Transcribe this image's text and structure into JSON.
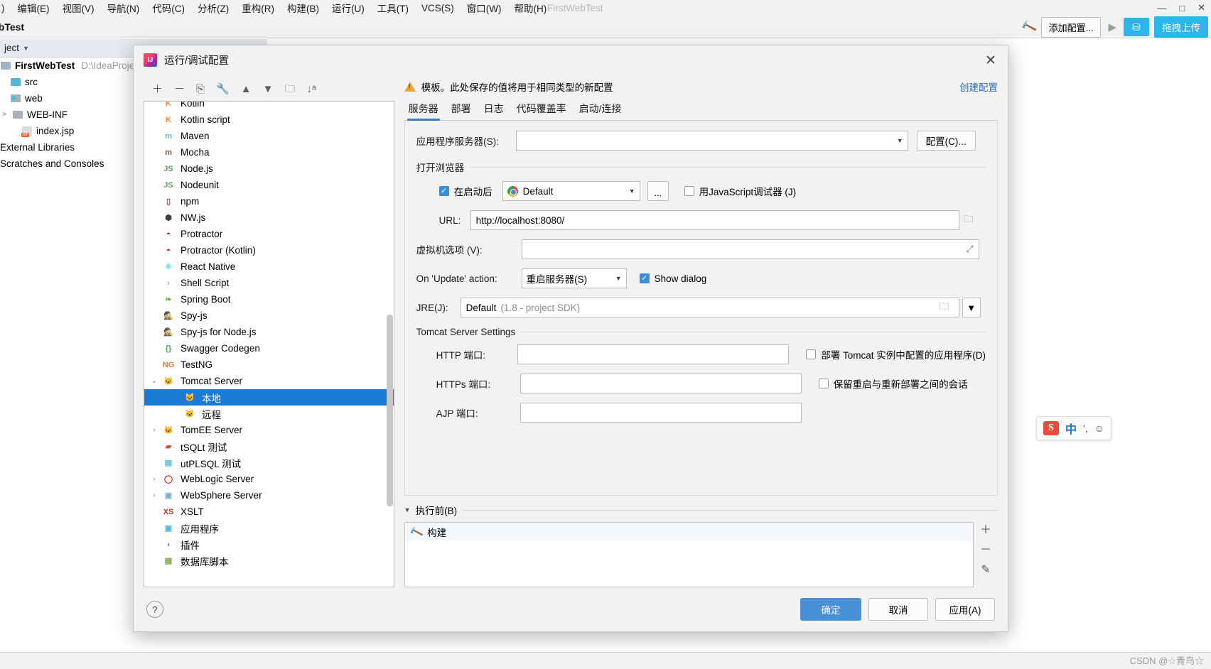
{
  "ide": {
    "window_title": "FirstWebTest",
    "menus": [
      {
        "label": "编辑(E)"
      },
      {
        "label": "视图(V)"
      },
      {
        "label": "导航(N)"
      },
      {
        "label": "代码(C)"
      },
      {
        "label": "分析(Z)"
      },
      {
        "label": "重构(R)"
      },
      {
        "label": "构建(B)"
      },
      {
        "label": "运行(U)"
      },
      {
        "label": "工具(T)"
      },
      {
        "label": "VCS(S)"
      },
      {
        "label": "窗口(W)"
      },
      {
        "label": "帮助(H)"
      }
    ],
    "window_controls": [
      "—",
      "□",
      "✕"
    ],
    "breadcrumb": "ebTest",
    "toolbar": {
      "add_config": "添加配置...",
      "upload": "拖拽上传",
      "cyan_badge": "⛁"
    },
    "tool_tab": "ject",
    "project_tree": [
      {
        "label": "FirstWebTest",
        "path": "D:\\IdeaProject",
        "icon": "module-icon",
        "indent": 0,
        "bold": true,
        "expander": ""
      },
      {
        "label": "src",
        "path": "",
        "icon": "folder-blue-icon",
        "indent": 1,
        "bold": false,
        "expander": ""
      },
      {
        "label": "web",
        "path": "",
        "icon": "web-folder-icon",
        "indent": 1,
        "bold": false,
        "expander": ""
      },
      {
        "label": "WEB-INF",
        "path": "",
        "icon": "folder-gray-icon",
        "indent": 2,
        "bold": false,
        "expander": ">"
      },
      {
        "label": "index.jsp",
        "path": "",
        "icon": "jsp-file-icon",
        "indent": 2,
        "bold": false,
        "expander": ""
      },
      {
        "label": "External Libraries",
        "path": "",
        "icon": "library-icon",
        "indent": 0,
        "bold": false,
        "expander": ""
      },
      {
        "label": "Scratches and Consoles",
        "path": "",
        "icon": "scratch-icon",
        "indent": 0,
        "bold": false,
        "expander": ""
      }
    ],
    "ime": {
      "logo": "S",
      "lang": "中",
      "comma": "',",
      "face": "☺"
    },
    "watermark": "CSDN @☆青鸟☆"
  },
  "dialog": {
    "title": "运行/调试配置",
    "close": "✕",
    "left_toolbar": [
      {
        "name": "add",
        "glyph": "＋"
      },
      {
        "name": "remove",
        "glyph": "－"
      },
      {
        "name": "copy",
        "glyph": "⎘"
      },
      {
        "name": "edit-templates",
        "glyph": "🔧"
      },
      {
        "name": "move-up",
        "glyph": "▲"
      },
      {
        "name": "move-down",
        "glyph": "▼"
      },
      {
        "name": "new-folder",
        "glyph": "🗀"
      },
      {
        "name": "sort",
        "glyph": "↓ᵃ"
      }
    ],
    "tree": [
      {
        "label": "Kotlin",
        "indent": 0,
        "expander": "",
        "icon": "kotlin-icon",
        "color": "#f08a2e",
        "selected": false,
        "partial": true
      },
      {
        "label": "Kotlin script",
        "indent": 0,
        "expander": "",
        "icon": "kotlin-script-icon",
        "color": "#f08a2e",
        "selected": false
      },
      {
        "label": "Maven",
        "indent": 0,
        "expander": "",
        "icon": "maven-icon",
        "color": "#6fb3d6",
        "selected": false
      },
      {
        "label": "Mocha",
        "indent": 0,
        "expander": "",
        "icon": "mocha-icon",
        "color": "#7b5a3a",
        "selected": false
      },
      {
        "label": "Node.js",
        "indent": 0,
        "expander": "",
        "icon": "nodejs-icon",
        "color": "#68a063",
        "selected": false
      },
      {
        "label": "Nodeunit",
        "indent": 0,
        "expander": "",
        "icon": "nodeunit-icon",
        "color": "#68a063",
        "selected": false
      },
      {
        "label": "npm",
        "indent": 0,
        "expander": "",
        "icon": "npm-icon",
        "color": "#cb3837",
        "selected": false
      },
      {
        "label": "NW.js",
        "indent": 0,
        "expander": "",
        "icon": "nwjs-icon",
        "color": "#3a3f4b",
        "selected": false
      },
      {
        "label": "Protractor",
        "indent": 0,
        "expander": "",
        "icon": "protractor-icon",
        "color": "#e02020",
        "selected": false
      },
      {
        "label": "Protractor (Kotlin)",
        "indent": 0,
        "expander": "",
        "icon": "protractor-kotlin-icon",
        "color": "#e02020",
        "selected": false
      },
      {
        "label": "React Native",
        "indent": 0,
        "expander": "",
        "icon": "react-native-icon",
        "color": "#61dafb",
        "selected": false
      },
      {
        "label": "Shell Script",
        "indent": 0,
        "expander": "",
        "icon": "shell-script-icon",
        "color": "#9aa0a6",
        "selected": false
      },
      {
        "label": "Spring Boot",
        "indent": 0,
        "expander": "",
        "icon": "spring-boot-icon",
        "color": "#6db33f",
        "selected": false
      },
      {
        "label": "Spy-js",
        "indent": 0,
        "expander": "",
        "icon": "spyjs-icon",
        "color": "#3f7fbf",
        "selected": false
      },
      {
        "label": "Spy-js for Node.js",
        "indent": 0,
        "expander": "",
        "icon": "spyjs-node-icon",
        "color": "#3f7fbf",
        "selected": false
      },
      {
        "label": "Swagger Codegen",
        "indent": 0,
        "expander": "",
        "icon": "swagger-icon",
        "color": "#4caf50",
        "selected": false
      },
      {
        "label": "TestNG",
        "indent": 0,
        "expander": "",
        "icon": "testng-icon",
        "color": "#e07b39",
        "selected": false
      },
      {
        "label": "Tomcat Server",
        "indent": 0,
        "expander": "v",
        "icon": "tomcat-icon",
        "color": "#c9a227",
        "selected": false
      },
      {
        "label": "本地",
        "indent": 1,
        "expander": "",
        "icon": "tomcat-icon",
        "color": "#c9a227",
        "selected": true
      },
      {
        "label": "远程",
        "indent": 1,
        "expander": "",
        "icon": "tomcat-icon",
        "color": "#c9a227",
        "selected": false
      },
      {
        "label": "TomEE Server",
        "indent": 0,
        "expander": ">",
        "icon": "tomee-icon",
        "color": "#c9a227",
        "selected": false
      },
      {
        "label": "tSQLt 测试",
        "indent": 0,
        "expander": "",
        "icon": "tsqlt-icon",
        "color": "#e04b3a",
        "selected": false
      },
      {
        "label": "utPLSQL 测试",
        "indent": 0,
        "expander": "",
        "icon": "utplsql-icon",
        "color": "#4db8d8",
        "selected": false
      },
      {
        "label": "WebLogic Server",
        "indent": 0,
        "expander": ">",
        "icon": "weblogic-icon",
        "color": "#e02020",
        "selected": false
      },
      {
        "label": "WebSphere Server",
        "indent": 0,
        "expander": ">",
        "icon": "websphere-icon",
        "color": "#7eb3d6",
        "selected": false
      },
      {
        "label": "XSLT",
        "indent": 0,
        "expander": "",
        "icon": "xslt-icon",
        "color": "#c0392b",
        "selected": false
      },
      {
        "label": "应用程序",
        "indent": 0,
        "expander": "",
        "icon": "application-icon",
        "color": "#4db8d8",
        "selected": false
      },
      {
        "label": "插件",
        "indent": 0,
        "expander": "",
        "icon": "plugin-icon",
        "color": "#8a8a8a",
        "selected": false
      },
      {
        "label": "数据库脚本",
        "indent": 0,
        "expander": "",
        "icon": "db-script-icon",
        "color": "#6a9a3a",
        "selected": false
      }
    ],
    "banner": {
      "text": "模板。此处保存的值将用于相同类型的新配置",
      "link": "创建配置"
    },
    "tabs": [
      {
        "label": "服务器",
        "active": true
      },
      {
        "label": "部署",
        "active": false
      },
      {
        "label": "日志",
        "active": false
      },
      {
        "label": "代码覆盖率",
        "active": false
      },
      {
        "label": "启动/连接",
        "active": false
      }
    ],
    "server_tab": {
      "app_server": {
        "label": "应用程序服务器(S):",
        "value": "",
        "configure_button": "配置(C)..."
      },
      "open_browser": {
        "group_label": "打开浏览器",
        "after_launch_label": "在启动后",
        "after_launch_checked": true,
        "browser": "Default",
        "dots_button": "...",
        "js_debugger_label": "用JavaScript调试器 (J)",
        "js_debugger_checked": false,
        "url_label": "URL:",
        "url_value": "http://localhost:8080/"
      },
      "vm_options": {
        "label": "虚拟机选项 (V):",
        "value": ""
      },
      "on_update": {
        "label": "On 'Update' action:",
        "value": "重启服务器(S)",
        "show_dialog_label": "Show dialog",
        "show_dialog_checked": true
      },
      "jre": {
        "label": "JRE(J):",
        "value": "Default",
        "hint": "(1.8 - project SDK)"
      },
      "tomcat_settings": {
        "group_label": "Tomcat Server Settings",
        "http_port_label": "HTTP 端口:",
        "http_port_value": "",
        "https_port_label": "HTTPs 端口:",
        "https_port_value": "",
        "ajp_port_label": "AJP 端口:",
        "ajp_port_value": "",
        "deploy_label": "部署 Tomcat 实例中配置的应用程序(D)",
        "deploy_checked": false,
        "preserve_label": "保留重启与重新部署之间的会话",
        "preserve_checked": false
      }
    },
    "before_launch": {
      "title": "执行前(B)",
      "items": [
        {
          "label": "构建",
          "icon": "build-hammer-icon"
        }
      ],
      "side_buttons": [
        {
          "name": "add",
          "glyph": "＋"
        },
        {
          "name": "remove",
          "glyph": "－"
        },
        {
          "name": "edit",
          "glyph": "✎"
        }
      ]
    },
    "footer": {
      "help": "?",
      "ok": "确定",
      "cancel": "取消",
      "apply": "应用(A)"
    }
  }
}
